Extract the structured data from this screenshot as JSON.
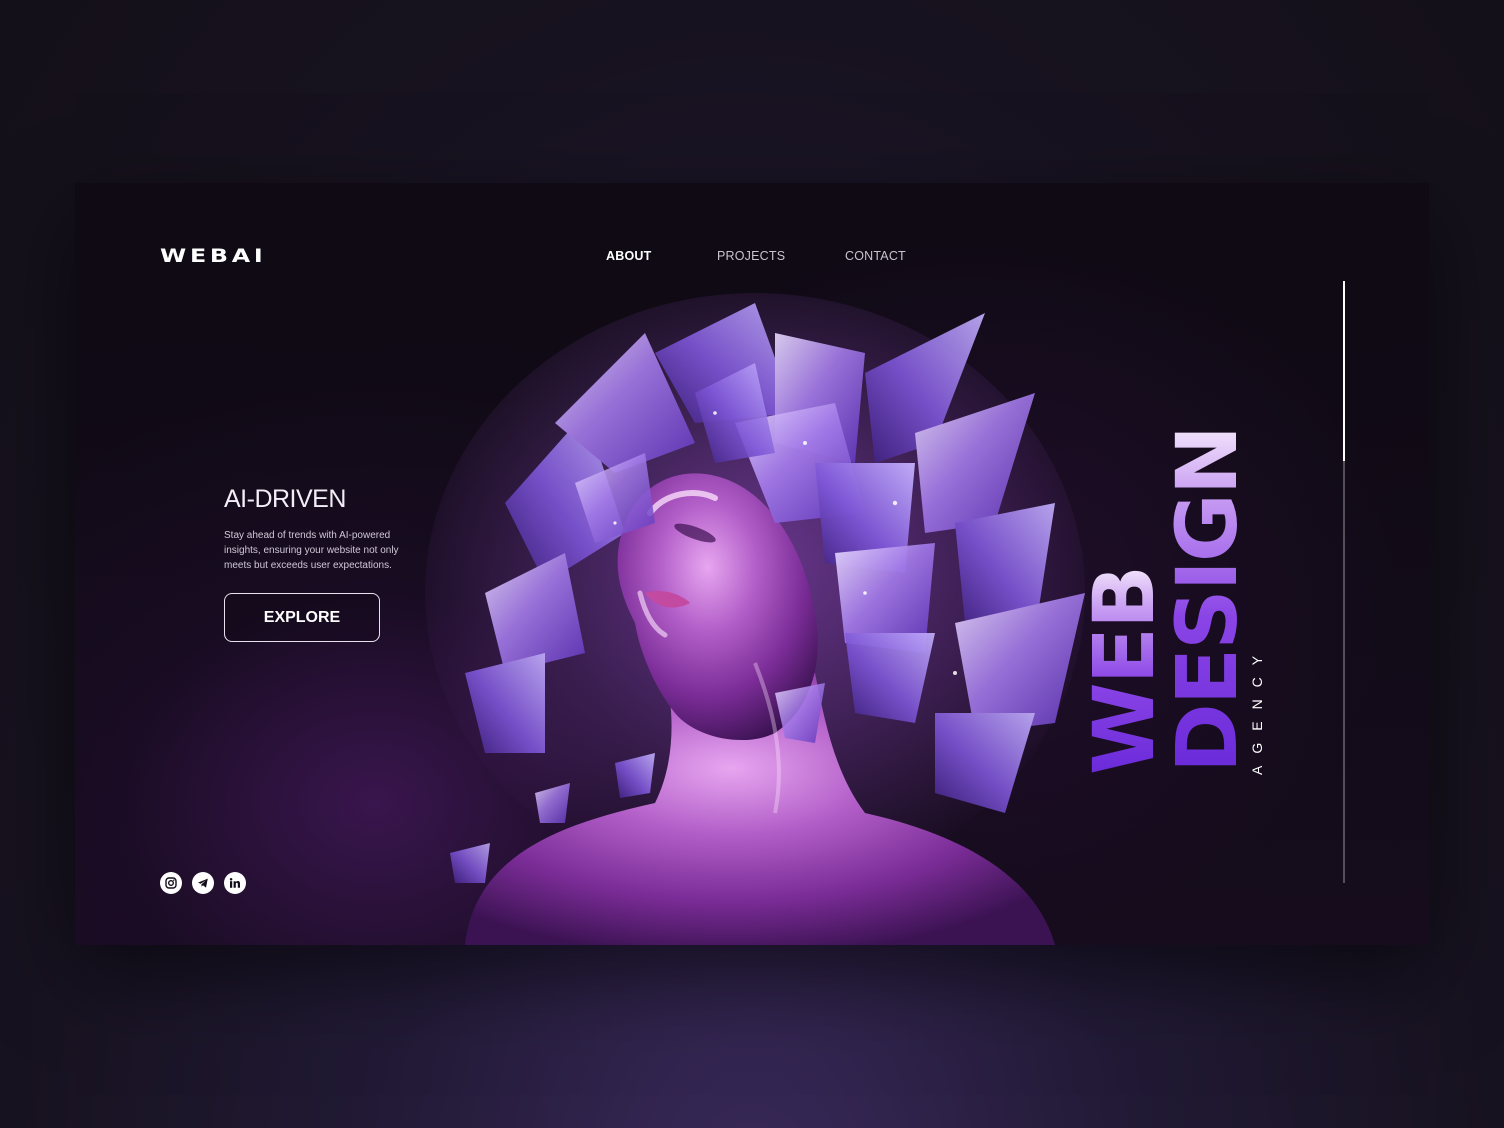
{
  "brand": {
    "logo": "WEBAI"
  },
  "nav": {
    "items": [
      {
        "label": "ABOUT",
        "active": true
      },
      {
        "label": "PROJECTS",
        "active": false
      },
      {
        "label": "CONTACT",
        "active": false
      }
    ]
  },
  "hero": {
    "subtitle": "AI-DRIVEN",
    "description": "Stay ahead of trends with AI-powered insights, ensuring your website not only meets but exceeds user expectations.",
    "cta_label": "EXPLORE",
    "headline_line1": "WEB",
    "headline_line2": "DESIGN",
    "tagline": "AGENCY"
  },
  "socials": [
    {
      "icon": "instagram-icon"
    },
    {
      "icon": "telegram-icon"
    },
    {
      "icon": "linkedin-icon"
    }
  ],
  "colors": {
    "accent_purple": "#7b3fe4",
    "accent_light": "#f2e4fb",
    "background": "#120b18",
    "outer_background": "#1b1528"
  }
}
